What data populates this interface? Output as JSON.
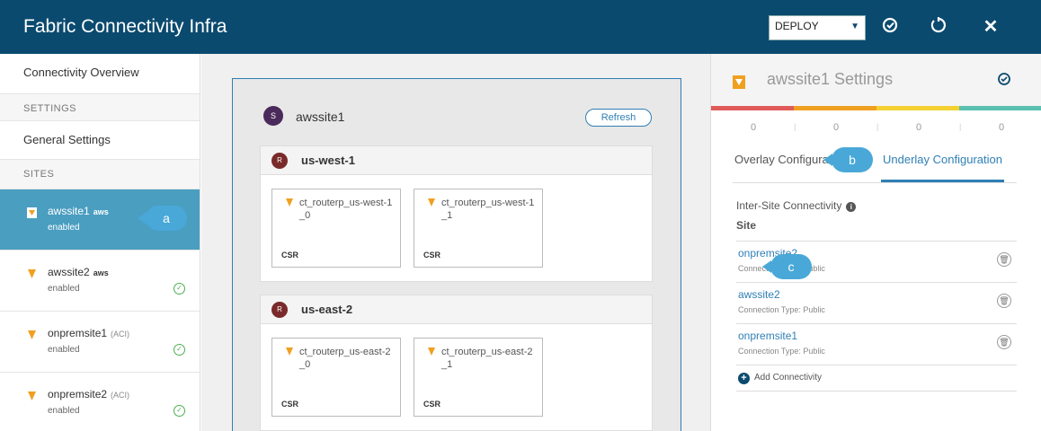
{
  "header": {
    "title": "Fabric Connectivity Infra",
    "mode_select": "DEPLOY",
    "sync_icon": "sync-icon",
    "refresh_icon": "reload-icon",
    "close_icon": "close-icon"
  },
  "sidebar": {
    "overview": "Connectivity Overview",
    "settings_heading": "SETTINGS",
    "general_settings": "General Settings",
    "sites_heading": "SITES",
    "sites": [
      {
        "name": "awssite1",
        "tag": "aws",
        "status": "enabled",
        "active": true
      },
      {
        "name": "awssite2",
        "tag": "aws",
        "status": "enabled",
        "active": false
      },
      {
        "name": "onpremsite1",
        "tag": "(ACI)",
        "status": "enabled",
        "active": false
      },
      {
        "name": "onpremsite2",
        "tag": "(ACI)",
        "status": "enabled",
        "active": false
      }
    ]
  },
  "callouts": {
    "a": "a",
    "b": "b",
    "c": "c"
  },
  "center": {
    "site_badge": "S",
    "site_name": "awssite1",
    "refresh_label": "Refresh",
    "regions": [
      {
        "badge": "R",
        "name": "us-west-1",
        "routers": [
          {
            "name": "ct_routerp_us-west-1_0",
            "type": "CSR"
          },
          {
            "name": "ct_routerp_us-west-1_1",
            "type": "CSR"
          }
        ]
      },
      {
        "badge": "R",
        "name": "us-east-2",
        "routers": [
          {
            "name": "ct_routerp_us-east-2_0",
            "type": "CSR"
          },
          {
            "name": "ct_routerp_us-east-2_1",
            "type": "CSR"
          }
        ]
      }
    ]
  },
  "right_panel": {
    "title": "awssite1 Settings",
    "status_colors": [
      "#e05a5a",
      "#f0a020",
      "#f4d030",
      "#5ac0b0"
    ],
    "counts": [
      "0",
      "0",
      "0",
      "0"
    ],
    "tabs": [
      "Overlay Configura",
      "Underlay Configuration"
    ],
    "inter_site_label": "Inter-Site Connectivity",
    "site_column": "Site",
    "connections": [
      {
        "name": "onpremsite2",
        "type": "Connection Type: Public"
      },
      {
        "name": "awssite2",
        "type": "Connection Type: Public"
      },
      {
        "name": "onpremsite1",
        "type": "Connection Type: Public"
      }
    ],
    "add_label": "Add Connectivity"
  }
}
